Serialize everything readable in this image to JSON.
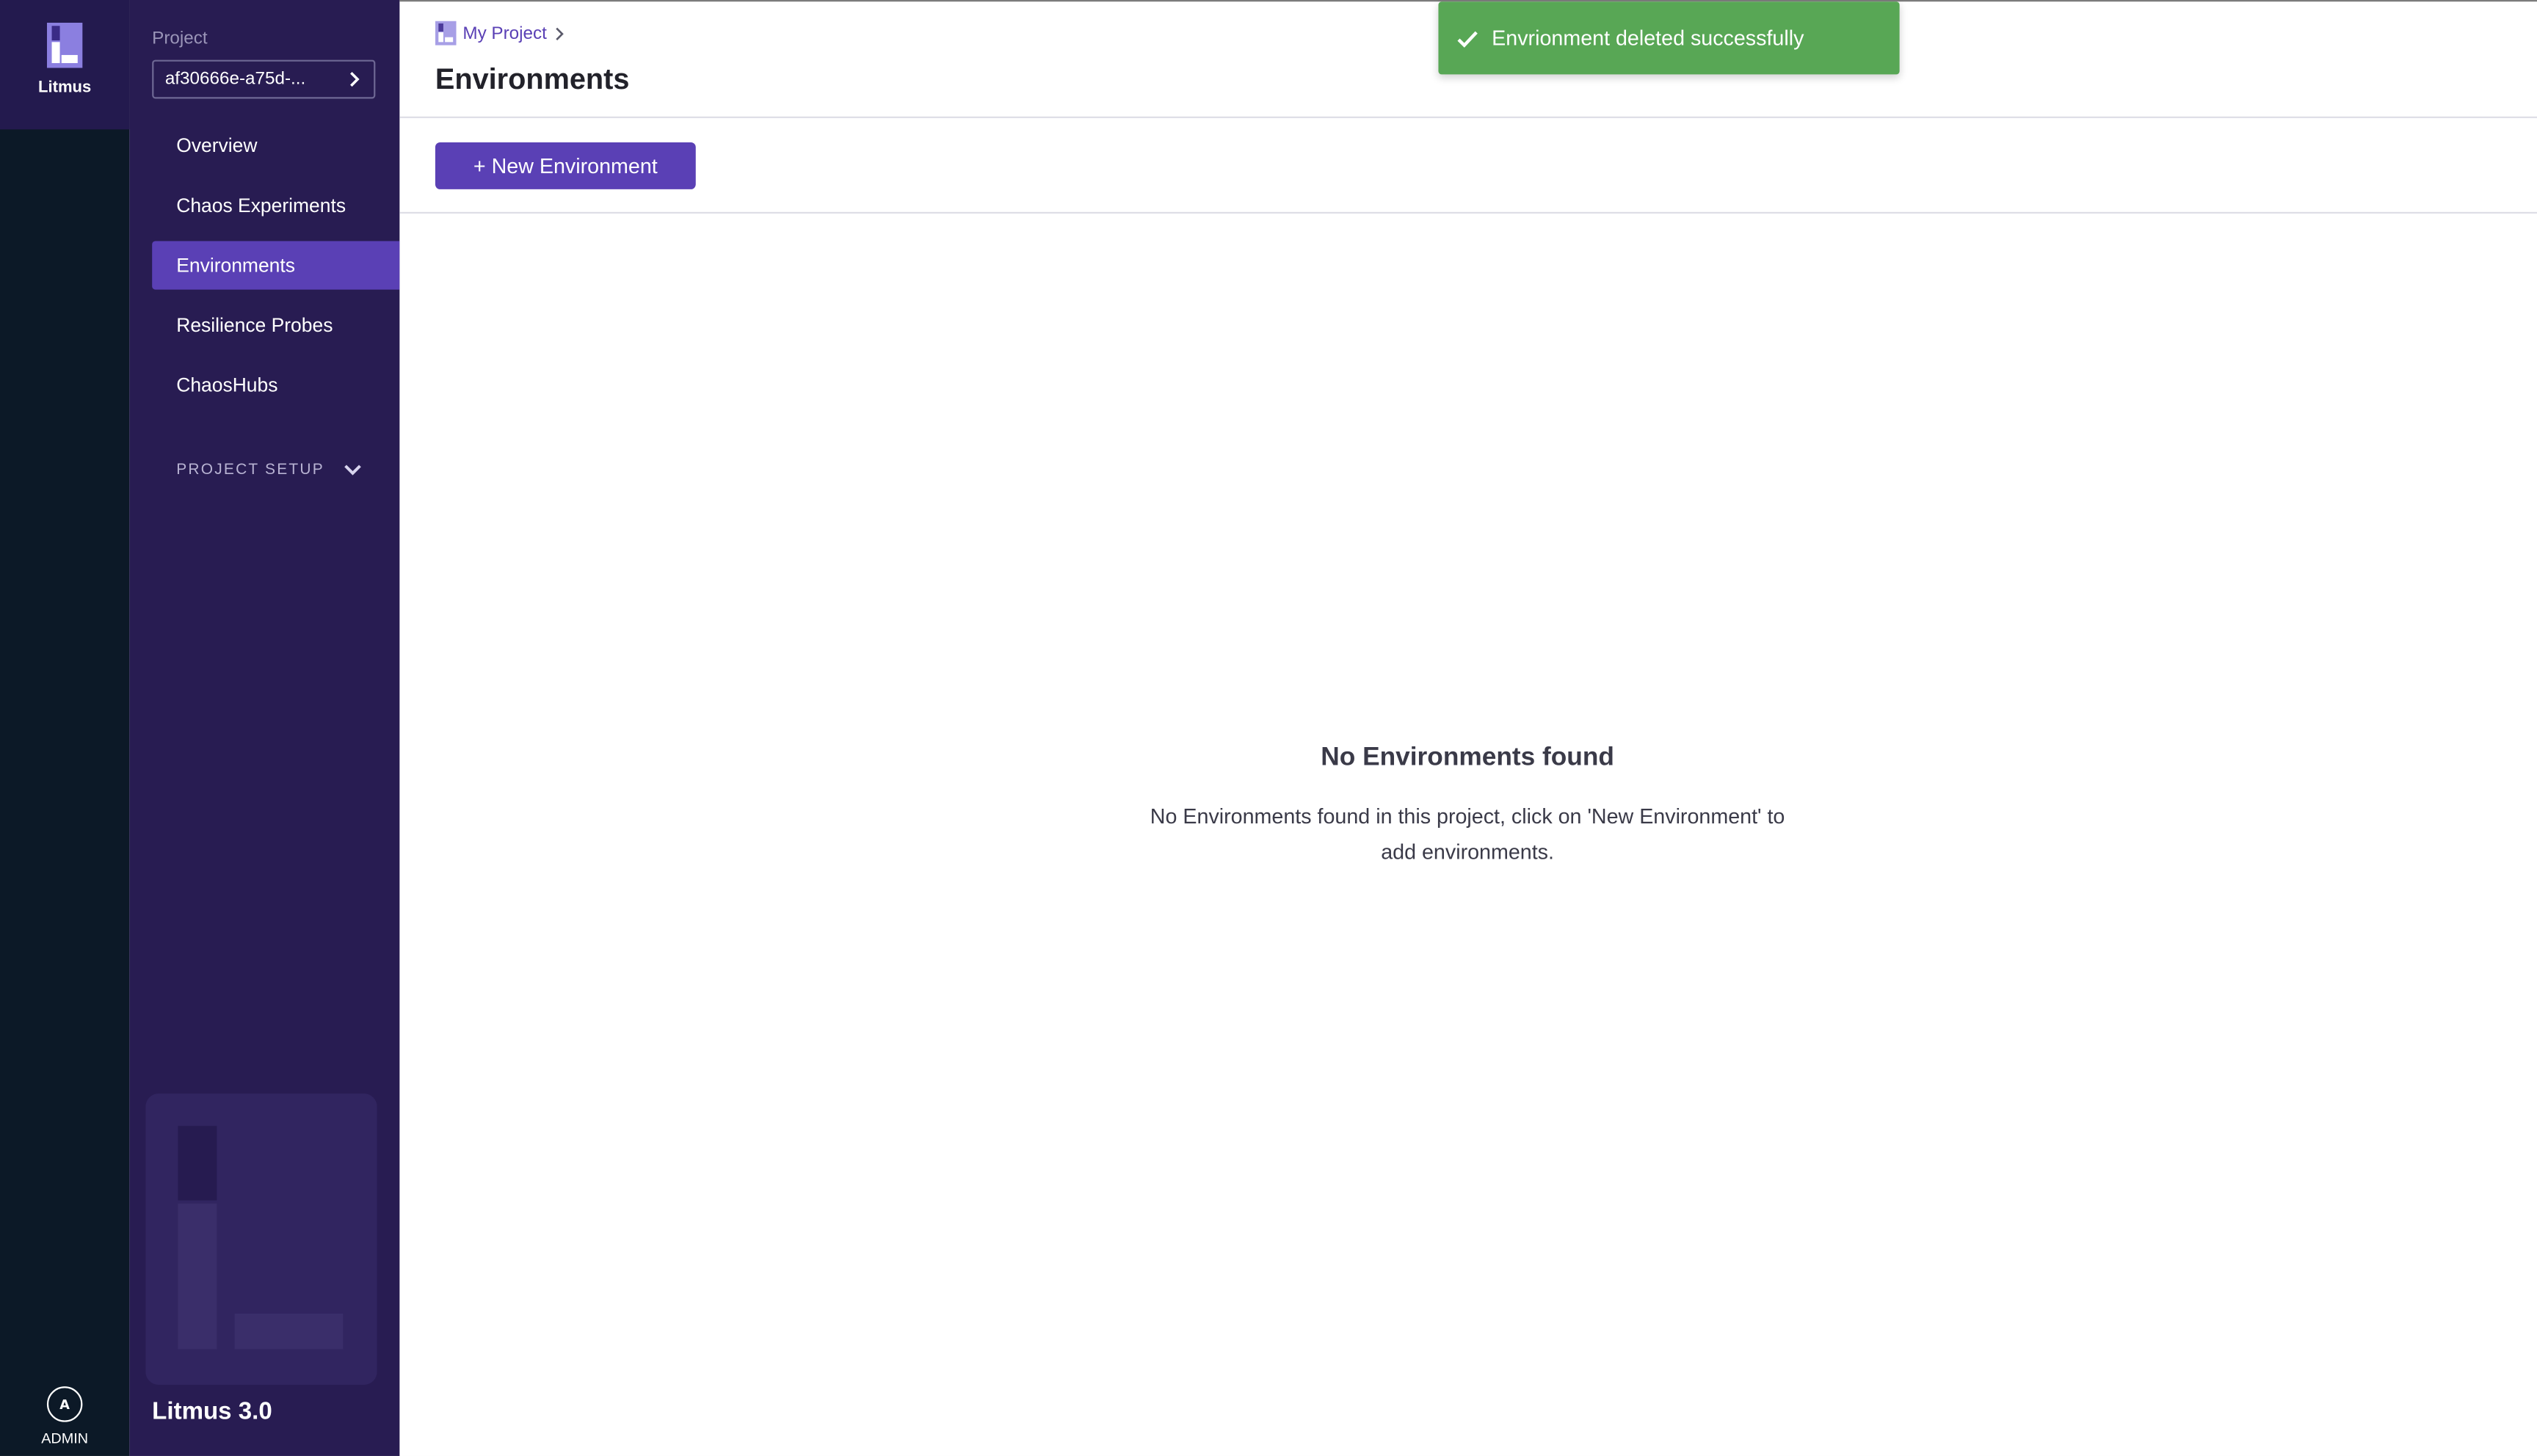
{
  "app": {
    "brand_label": "Litmus",
    "user_initial": "A",
    "user_label": "ADMIN"
  },
  "sidebar": {
    "project_label": "Project",
    "project_id": "af30666e-a75d-...",
    "items": [
      {
        "label": "Overview",
        "active": false
      },
      {
        "label": "Chaos Experiments",
        "active": false
      },
      {
        "label": "Environments",
        "active": true
      },
      {
        "label": "Resilience Probes",
        "active": false
      },
      {
        "label": "ChaosHubs",
        "active": false
      }
    ],
    "setup_label": "PROJECT SETUP",
    "version": "Litmus 3.0"
  },
  "header": {
    "breadcrumb": "My Project",
    "title": "Environments"
  },
  "toolbar": {
    "new_label": "+ New Environment"
  },
  "empty_state": {
    "title": "No Environments found",
    "text_line1": "No Environments found in this project, click on 'New Environment' to",
    "text_line2": "add environments."
  },
  "toast": {
    "message": "Envrionment deleted successfully"
  },
  "colors": {
    "accent": "#5a40b5",
    "rail": "#0c1927",
    "sidebar": "#281c52",
    "toast_success": "#58a755"
  },
  "icons": {
    "brand": "litmus-logo-icon",
    "avatar": "avatar-icon",
    "project_chevron": "chevron-right-icon",
    "setup_chevron": "chevron-down-icon",
    "collapse": "caret-left-icon",
    "breadcrumb_project": "project-icon",
    "toast_check": "check-icon"
  }
}
